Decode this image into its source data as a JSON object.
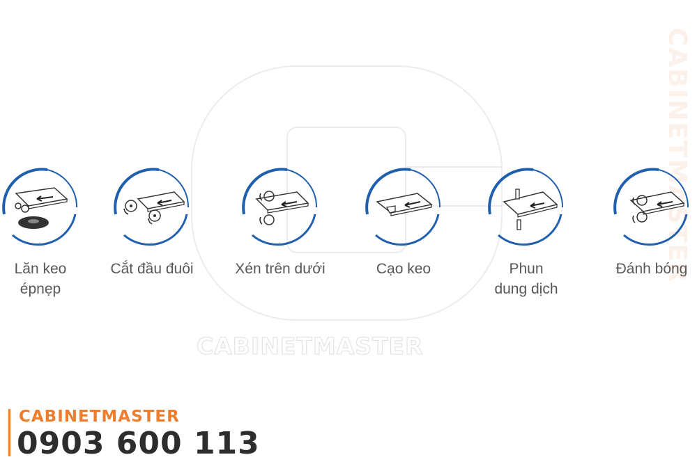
{
  "watermark": {
    "center_text": "CABINETMASTER",
    "side_text": "CABINETMASTER"
  },
  "steps": [
    {
      "label": "Lăn keo\népnẹp",
      "icon": "glue-roller-icon"
    },
    {
      "label": "Cắt đầu đuôi",
      "icon": "end-cutting-icon"
    },
    {
      "label": "Xén trên dưới",
      "icon": "top-bottom-trimming-icon"
    },
    {
      "label": "Cạo keo",
      "icon": "glue-scraping-icon"
    },
    {
      "label": "Phun\ndung dịch",
      "icon": "spray-solution-icon"
    },
    {
      "label": "Đánh bóng",
      "icon": "polishing-icon"
    }
  ],
  "footer": {
    "brand": "CABINETMASTER",
    "phone": "0903 600 113"
  },
  "colors": {
    "ring_blue": "#1f5fae",
    "label_gray": "#575757",
    "brand_orange": "#ee7d2d"
  }
}
